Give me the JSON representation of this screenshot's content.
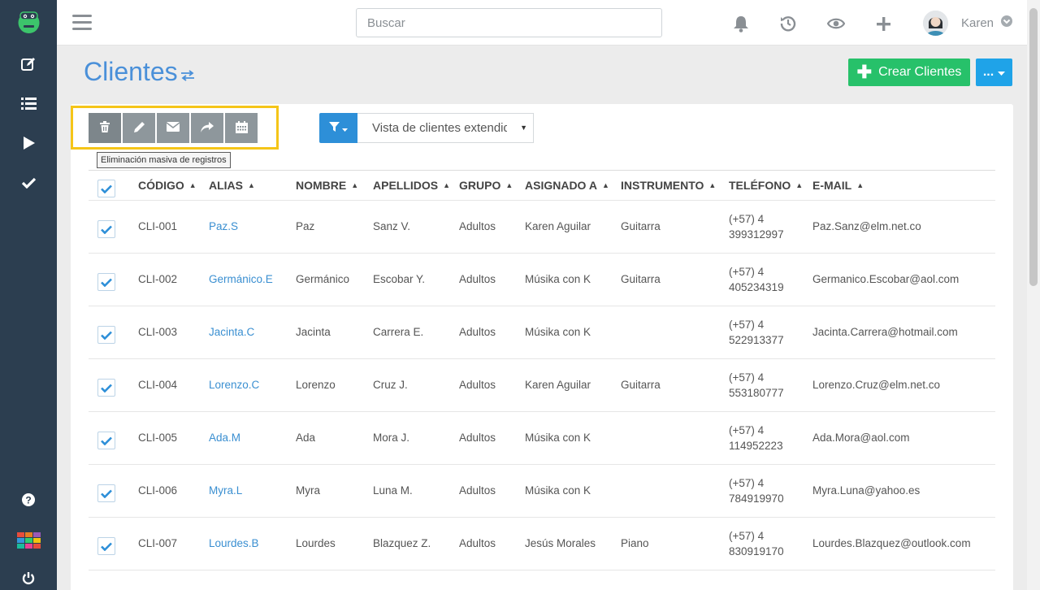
{
  "topbar": {
    "search_placeholder": "Buscar",
    "user_name": "Karen"
  },
  "page": {
    "title": "Clientes",
    "create_button_label": "Crear Clientes",
    "more_button_label": "..."
  },
  "bulk_actions": {
    "tooltip": "Eliminación masiva de registros"
  },
  "view": {
    "selected": "Vista de clientes extendida"
  },
  "colors": {
    "sidebar": "#2c3e50",
    "title": "#4a90d9",
    "create": "#27c16a",
    "more": "#1fa3e8",
    "filter": "#2d8fd8",
    "highlight": "#f5c518",
    "link": "#3a8fd1"
  },
  "table": {
    "headers": [
      "CÓDIGO",
      "ALIAS",
      "NOMBRE",
      "APELLIDOS",
      "GRUPO",
      "ASIGNADO A",
      "INSTRUMENTO",
      "TELÉFONO",
      "E-MAIL"
    ],
    "rows": [
      {
        "code": "CLI-001",
        "alias": "Paz.S",
        "name": "Paz",
        "last": "Sanz V.",
        "group": "Adultos",
        "assigned": "Karen Aguilar",
        "instrument": "Guitarra",
        "phone": "(+57) 4 399312997",
        "email": "Paz.Sanz@elm.net.co"
      },
      {
        "code": "CLI-002",
        "alias": "Germánico.E",
        "name": "Germánico",
        "last": "Escobar Y.",
        "group": "Adultos",
        "assigned": "Músika con K",
        "instrument": "Guitarra",
        "phone": "(+57) 4 405234319",
        "email": "Germanico.Escobar@aol.com"
      },
      {
        "code": "CLI-003",
        "alias": "Jacinta.C",
        "name": "Jacinta",
        "last": "Carrera E.",
        "group": "Adultos",
        "assigned": "Músika con K",
        "instrument": "",
        "phone": "(+57) 4 522913377",
        "email": "Jacinta.Carrera@hotmail.com"
      },
      {
        "code": "CLI-004",
        "alias": "Lorenzo.C",
        "name": "Lorenzo",
        "last": "Cruz J.",
        "group": "Adultos",
        "assigned": "Karen Aguilar",
        "instrument": "Guitarra",
        "phone": "(+57) 4 553180777",
        "email": "Lorenzo.Cruz@elm.net.co"
      },
      {
        "code": "CLI-005",
        "alias": "Ada.M",
        "name": "Ada",
        "last": "Mora J.",
        "group": "Adultos",
        "assigned": "Músika con K",
        "instrument": "",
        "phone": "(+57) 4 114952223",
        "email": "Ada.Mora@aol.com"
      },
      {
        "code": "CLI-006",
        "alias": "Myra.L",
        "name": "Myra",
        "last": "Luna M.",
        "group": "Adultos",
        "assigned": "Músika con K",
        "instrument": "",
        "phone": "(+57) 4 784919970",
        "email": "Myra.Luna@yahoo.es"
      },
      {
        "code": "CLI-007",
        "alias": "Lourdes.B",
        "name": "Lourdes",
        "last": "Blazquez Z.",
        "group": "Adultos",
        "assigned": "Jesús Morales",
        "instrument": "Piano",
        "phone": "(+57) 4 830919170",
        "email": "Lourdes.Blazquez@outlook.com"
      }
    ]
  }
}
